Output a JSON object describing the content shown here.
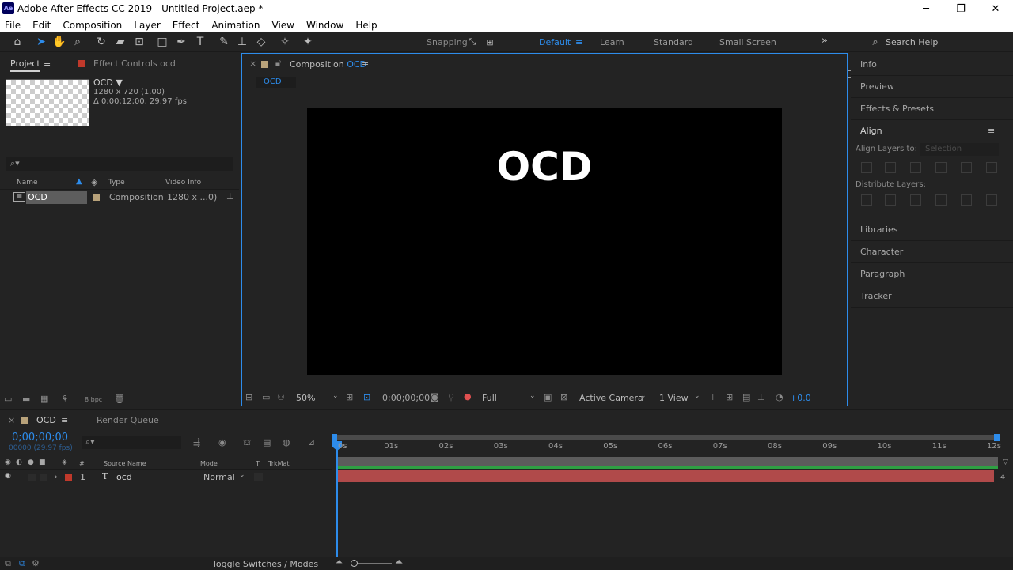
{
  "window": {
    "title": "Adobe After Effects CC 2019 - Untitled Project.aep *",
    "logo": "Ae",
    "controls": [
      "─",
      "❐",
      "✕"
    ]
  },
  "menu": [
    "File",
    "Edit",
    "Composition",
    "Layer",
    "Effect",
    "Animation",
    "View",
    "Window",
    "Help"
  ],
  "toolbar": {
    "snapping_label": "Snapping",
    "workspaces": [
      "Default",
      "Learn",
      "Standard",
      "Small Screen"
    ],
    "active_workspace": "Default",
    "search_placeholder": "Search Help"
  },
  "project": {
    "tab_label": "Project",
    "effect_controls_label": "Effect Controls ocd",
    "comp_name": "OCD",
    "comp_size": "1280 x 720  (1.00)",
    "comp_duration": "Δ 0;00;12;00, 29.97 fps",
    "search_icon": "search-icon",
    "columns": [
      "Name",
      "Type",
      "Video Info"
    ],
    "items": [
      {
        "name": "OCD",
        "type": "Composition",
        "video_info": "1280 x ...0)"
      }
    ],
    "bpc": "8 bpc"
  },
  "composition": {
    "tab_label": "Composition",
    "comp_name": "OCD",
    "breadcrumb": "OCD",
    "text_layer": "OCD",
    "zoom": "50%",
    "timecode": "0;00;00;00",
    "resolution": "Full",
    "camera": "Active Camera",
    "view": "1 View",
    "exposure": "+0.0"
  },
  "right_panel": {
    "items": [
      "Info",
      "Preview",
      "Effects & Presets"
    ],
    "align_title": "Align",
    "align_layers_to": "Align Layers to:",
    "align_to_value": "Selection",
    "distribute_label": "Distribute Layers:",
    "more_items": [
      "Libraries",
      "Character",
      "Paragraph",
      "Tracker"
    ]
  },
  "timeline": {
    "tab_label": "OCD",
    "render_queue": "Render Queue",
    "timecode": "0;00;00;00",
    "frame_info": "00000 (29.97 fps)",
    "columns": {
      "hash": "#",
      "source_name": "Source Name",
      "mode": "Mode",
      "t": "T",
      "trkmat": "TrkMat"
    },
    "layers": [
      {
        "num": "1",
        "type_icon": "T",
        "name": "ocd",
        "mode": "Normal"
      }
    ],
    "ruler": [
      "0s",
      "01s",
      "02s",
      "03s",
      "04s",
      "05s",
      "06s",
      "07s",
      "08s",
      "09s",
      "10s",
      "11s",
      "12s"
    ],
    "toggle_label": "Toggle Switches / Modes"
  },
  "colors": {
    "accent": "#2d8ceb",
    "layer_bar": "#b04a4a",
    "label_red": "#c0392b",
    "label_tan": "#b8a27a"
  }
}
